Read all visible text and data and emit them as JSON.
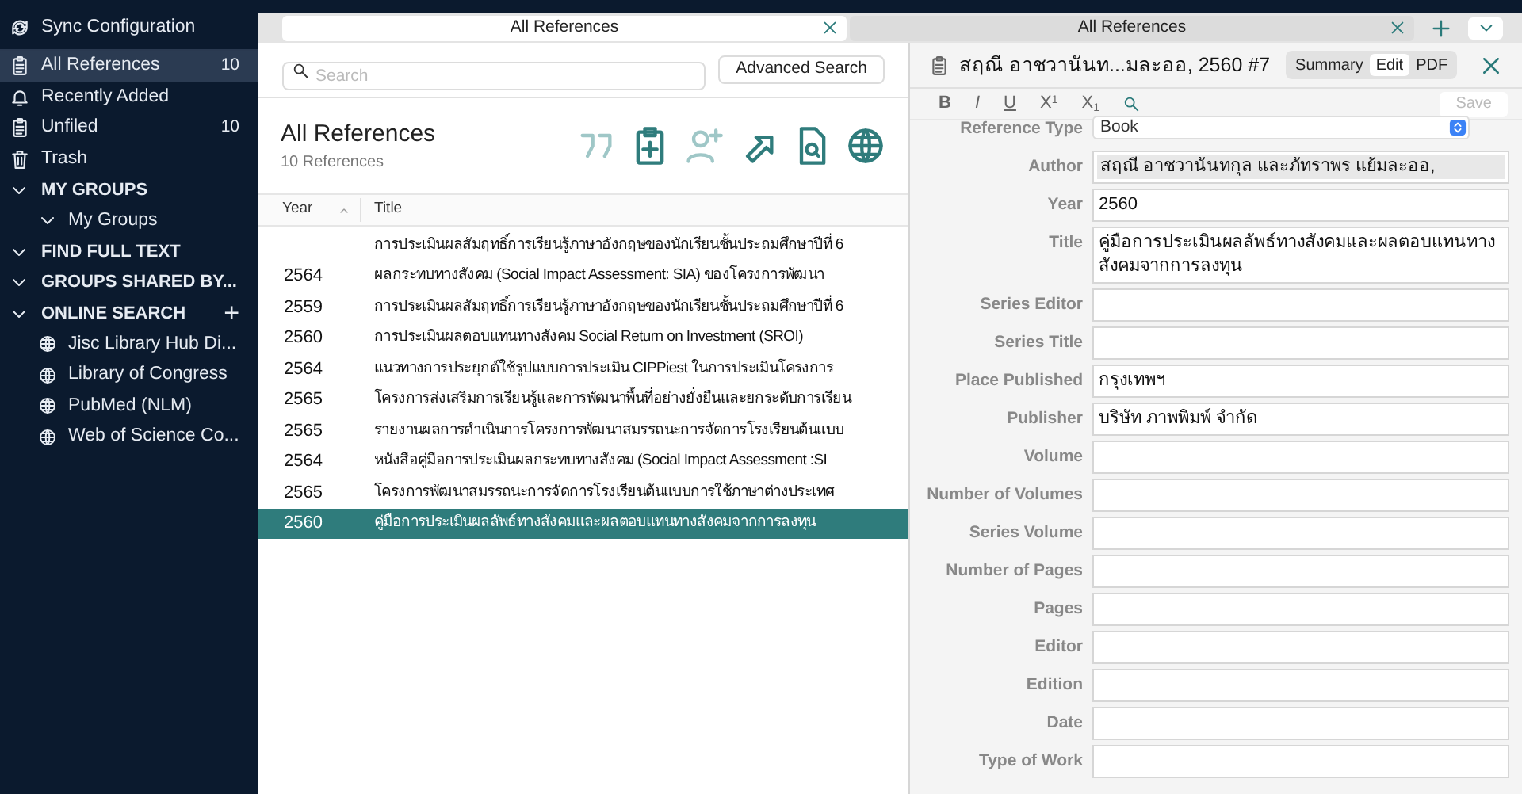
{
  "sidebar": {
    "sync": {
      "label": "Sync Configuration"
    },
    "items": [
      {
        "label": "All References",
        "count": "10",
        "selected": true
      },
      {
        "label": "Recently Added",
        "selected": false
      },
      {
        "label": "Unfiled",
        "count": "10",
        "selected": false
      },
      {
        "label": "Trash",
        "selected": false
      }
    ],
    "sections": [
      {
        "label": "MY GROUPS",
        "expanded": true,
        "children": [
          {
            "label": "My Groups",
            "expanded": true
          }
        ]
      },
      {
        "label": "FIND FULL TEXT",
        "expanded": true
      },
      {
        "label": "GROUPS SHARED BY...",
        "expanded": true
      },
      {
        "label": "ONLINE SEARCH",
        "expanded": true,
        "add_button": "+",
        "children": [
          {
            "label": "Jisc Library Hub Di..."
          },
          {
            "label": "Library of Congress"
          },
          {
            "label": "PubMed (NLM)"
          },
          {
            "label": "Web of Science Co..."
          }
        ]
      }
    ]
  },
  "tabs": [
    {
      "label": "All References",
      "selected": true
    },
    {
      "label": "All References",
      "selected": false
    }
  ],
  "list": {
    "search": {
      "placeholder": "Search"
    },
    "advanced_search": "Advanced Search",
    "title": "All References",
    "count": "10 References",
    "columns": [
      "Year",
      "Title"
    ],
    "rows": [
      {
        "title": "การประเมินผลสัมฤทธิ์การเรียนรู้ภาษาอังกฤษของนักเรียนชั้นประถมศึกษาปีที่ 6",
        "selected": false
      },
      {
        "year": "2564",
        "title": "ผลกระทบทางสังคม (Social Impact Assessment: SIA) ของโครงการพัฒนา",
        "selected": false
      },
      {
        "year": "2559",
        "title": "การประเมินผลสัมฤทธิ์การเรียนรู้ภาษาอังกฤษของนักเรียนชั้นประถมศึกษาปีที่ 6",
        "selected": false
      },
      {
        "year": "2560",
        "title": "การประเมินผลตอบแทนทางสังคม Social Return on Investment (SROI)",
        "selected": false
      },
      {
        "year": "2564",
        "title": "แนวทางการประยุกต์ใช้รูปแบบการประเมิน CIPPiest ในการประเมินโครงการ",
        "selected": false
      },
      {
        "year": "2565",
        "title": "โครงการส่งเสริมการเรียนรู้และการพัฒนาพื้นที่อย่างยั่งยืนและยกระดับการเรียน",
        "selected": false
      },
      {
        "year": "2565",
        "title": "รายงานผลการดำเนินการโครงการพัฒนาสมรรถนะการจัดการโรงเรียนต้นแบบ",
        "selected": false
      },
      {
        "year": "2564",
        "title": "หนังสือคู่มือการประเมินผลกระทบทางสังคม (Social Impact Assessment :SI",
        "selected": false
      },
      {
        "year": "2565",
        "title": "โครงการพัฒนาสมรรถนะการจัดการโรงเรียนต้นแบบการใช้ภาษาต่างประเทศ",
        "selected": false
      },
      {
        "year": "2560",
        "title": "คู่มือการประเมินผลลัพธ์ทางสังคมและผลตอบแทนทางสังคมจากการลงทุน",
        "selected": true
      }
    ]
  },
  "detail": {
    "title": "สฤณี อาชวานันท...มละออ, 2560 #7",
    "modes": [
      {
        "label": "Summary",
        "selected": false
      },
      {
        "label": "Edit",
        "selected": true
      },
      {
        "label": "PDF",
        "selected": false
      }
    ],
    "format_buttons": [
      {
        "kind": "bold",
        "label": "B"
      },
      {
        "kind": "italic",
        "label": "I"
      },
      {
        "kind": "underline",
        "label": "U"
      },
      {
        "kind": "sup",
        "label": "X",
        "mark": "1"
      },
      {
        "kind": "sub",
        "label": "X",
        "mark": "1"
      }
    ],
    "save": {
      "label": "Save",
      "disabled": true
    },
    "fields": [
      {
        "kind": "select",
        "label": "Reference Type",
        "value": "Book"
      },
      {
        "kind": "author",
        "label": "Author",
        "value": "สฤณี อาชวานันทกุล และภัทราพร แย้มละออ,"
      },
      {
        "kind": "text",
        "label": "Year",
        "value": "2560"
      },
      {
        "kind": "multiline",
        "label": "Title",
        "value": "คู่มือการประเมินผลลัพธ์ทางสังคมและผลตอบแทนทางสังคมจากการลงทุน"
      },
      {
        "kind": "text",
        "label": "Series Editor"
      },
      {
        "kind": "text",
        "label": "Series Title"
      },
      {
        "kind": "text",
        "label": "Place Published",
        "value": "กรุงเทพฯ"
      },
      {
        "kind": "text",
        "label": "Publisher",
        "value": "บริษัท ภาพพิมพ์ จำกัด"
      },
      {
        "kind": "text",
        "label": "Volume"
      },
      {
        "kind": "text",
        "label": "Number of Volumes"
      },
      {
        "kind": "text",
        "label": "Series Volume"
      },
      {
        "kind": "text",
        "label": "Number of Pages"
      },
      {
        "kind": "text",
        "label": "Pages"
      },
      {
        "kind": "text",
        "label": "Editor"
      },
      {
        "kind": "text",
        "label": "Edition"
      },
      {
        "kind": "text",
        "label": "Date"
      },
      {
        "kind": "text",
        "label": "Type of Work"
      }
    ]
  }
}
